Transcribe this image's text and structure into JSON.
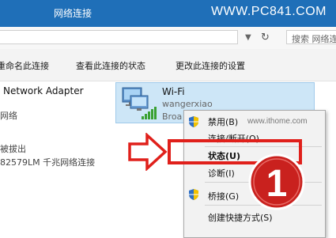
{
  "window": {
    "title": "网络连接",
    "watermark": "WWW.PC841.COM"
  },
  "address_bar": {
    "search_placeholder": "搜索 网络连"
  },
  "command_bar": {
    "rename": "重命名此连接",
    "view_status": "查看此连接的状态",
    "change_settings": "更改此连接的设置"
  },
  "adapters": {
    "left": {
      "name": "Network Adapter",
      "line2": "网络",
      "line3": "被拔出",
      "line4": "82579LM 千兆网络连接"
    },
    "wifi": {
      "name": "Wi-Fi",
      "ssid": "wangerxiao",
      "device_partial": "Broa"
    }
  },
  "context_menu": {
    "items": [
      {
        "label": "禁用(B)",
        "shield": true
      },
      {
        "label": "连接/断开(O)",
        "shield": false
      },
      {
        "label": "状态(U)",
        "shield": false,
        "bold": true
      },
      {
        "label": "诊断(I)",
        "shield": false
      },
      {
        "label": "桥接(G)",
        "shield": true
      },
      {
        "label": "创建快捷方式(S)",
        "shield": false
      }
    ]
  },
  "annotations": {
    "ithome_watermark": "www.ithome.com",
    "step_number": "1",
    "highlight_color": "#e0201b"
  },
  "icons": {
    "search": "search-icon",
    "refresh": "refresh-icon",
    "dropdown": "chevron-down-icon",
    "shield": "uac-shield-icon",
    "network": "network-adapter-icon",
    "arrow": "red-outline-arrow-icon"
  }
}
